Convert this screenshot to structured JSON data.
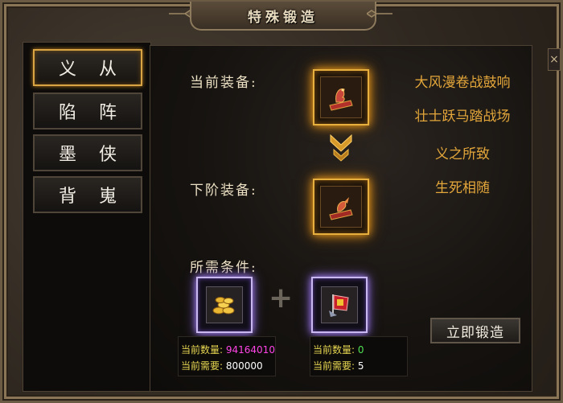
{
  "window": {
    "title": "特殊锻造",
    "close_glyph": "×"
  },
  "sidebar": {
    "items": [
      {
        "label": "义从",
        "active": true
      },
      {
        "label": "陷阵",
        "active": false
      },
      {
        "label": "墨侠",
        "active": false
      },
      {
        "label": "背嵬",
        "active": false
      }
    ]
  },
  "main": {
    "current_label": "当前装备:",
    "next_label": "下阶装备:",
    "requirements_label": "所需条件:",
    "attributes": [
      "大风漫卷战鼓响",
      "壮士跃马踏战场",
      "义之所致",
      "生死相随"
    ],
    "current_item_icon": "war-banner-dragon-icon",
    "next_item_icon": "war-banner-phoenix-icon",
    "plus_glyph": "+",
    "materials": [
      {
        "icon": "gold-coins-icon",
        "qty_key": "当前数量:",
        "qty_value": "94164010",
        "need_key": "当前需要:",
        "need_value": "800000"
      },
      {
        "icon": "red-flag-token-icon",
        "qty_key": "当前数量:",
        "qty_value": "0",
        "need_key": "当前需要:",
        "need_value": "5"
      }
    ],
    "forge_button": "立即锻造"
  },
  "colors": {
    "gold_glow": "#e7b03e",
    "purple_glow": "#c9b7f0",
    "attr_text": "#e3a63a",
    "qty_magenta": "#ff44e6",
    "qty_green": "#50e050"
  }
}
